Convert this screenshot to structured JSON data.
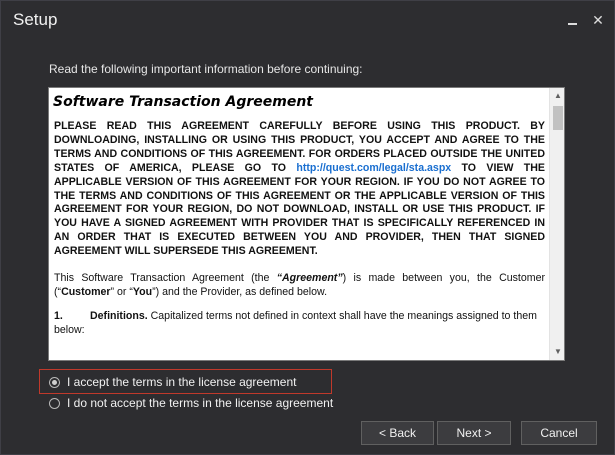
{
  "window": {
    "title": "Setup",
    "minimize_glyph": "_",
    "close_glyph": "✕"
  },
  "intro_text": "Read the following important information before continuing:",
  "license": {
    "title": "Software Transaction Agreement",
    "caps_part1": "PLEASE READ THIS AGREEMENT CAREFULLY BEFORE USING THIS PRODUCT. BY DOWNLOADING, INSTALLING OR USING THIS PRODUCT, YOU ACCEPT AND AGREE TO THE TERMS AND CONDITIONS OF THIS AGREEMENT. FOR ORDERS PLACED OUTSIDE THE UNITED STATES OF AMERICA, PLEASE GO TO ",
    "link_text": "http://quest.com/legal/sta.aspx",
    "caps_part2": " TO VIEW THE APPLICABLE VERSION OF THIS AGREEMENT FOR YOUR REGION. IF YOU DO NOT AGREE TO THE TERMS AND CONDITIONS OF THIS AGREEMENT OR THE APPLICABLE VERSION OF THIS AGREEMENT FOR YOUR REGION, DO NOT DOWNLOAD, INSTALL OR USE THIS PRODUCT. IF YOU HAVE A SIGNED AGREEMENT WITH PROVIDER THAT IS SPECIFICALLY REFERENCED IN AN ORDER THAT IS EXECUTED BETWEEN YOU AND PROVIDER, THEN THAT SIGNED AGREEMENT WILL SUPERSEDE THIS AGREEMENT.",
    "para_prefix": "This Software Transaction Agreement (the ",
    "para_term1": "“Agreement”",
    "para_mid1": ") is made between you, the Customer (“",
    "para_term2": "Customer",
    "para_mid2": "” or “",
    "para_term3": "You",
    "para_suffix": "”) and the Provider, as defined below.",
    "def_number": "1.",
    "def_heading": "Definitions.",
    "def_text": " Capitalized terms not defined in context shall have the meanings assigned to them below:"
  },
  "radios": {
    "accept_label": "I accept the terms in the license agreement",
    "decline_label": "I do not accept the terms in the license agreement",
    "selected": "accept"
  },
  "buttons": {
    "back": "< Back",
    "next": "Next >",
    "cancel": "Cancel"
  },
  "colors": {
    "background": "#2d2d30",
    "link": "#1a6fd0",
    "highlight": "#c0392b"
  }
}
